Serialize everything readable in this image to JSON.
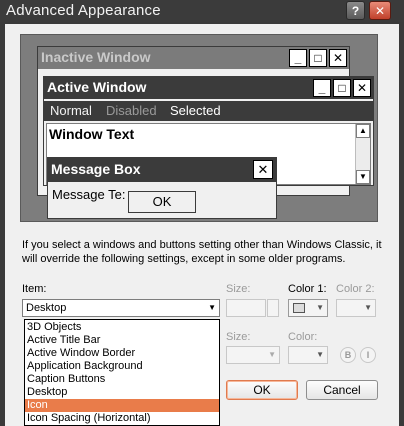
{
  "window": {
    "title": "Advanced Appearance",
    "help_label": "?",
    "close_label": "✕"
  },
  "preview": {
    "inactive_title": "Inactive Window",
    "active_title": "Active Window",
    "menu": {
      "normal": "Normal",
      "disabled": "Disabled",
      "selected": "Selected"
    },
    "window_text": "Window Text",
    "message_box": {
      "title": "Message Box",
      "text": "Message Te:",
      "ok": "OK",
      "close": "✕"
    },
    "caption_glyphs": {
      "minimize": "_",
      "maximize": "□",
      "close": "✕"
    }
  },
  "hint_text": "If you select a windows and buttons setting other than Windows Classic, it will override the following settings, except in some older programs.",
  "item": {
    "label": "Item:",
    "selected": "Desktop",
    "options": [
      "3D Objects",
      "Active Title Bar",
      "Active Window Border",
      "Application Background",
      "Caption Buttons",
      "Desktop",
      "Icon",
      "Icon Spacing (Horizontal)"
    ],
    "highlighted_index": 6
  },
  "size_label": "Size:",
  "color1_label": "Color 1:",
  "color2_label": "Color 2:",
  "font_size_label": "Size:",
  "font_color_label": "Color:",
  "bold_label": "B",
  "italic_label": "I",
  "buttons": {
    "ok": "OK",
    "cancel": "Cancel"
  }
}
